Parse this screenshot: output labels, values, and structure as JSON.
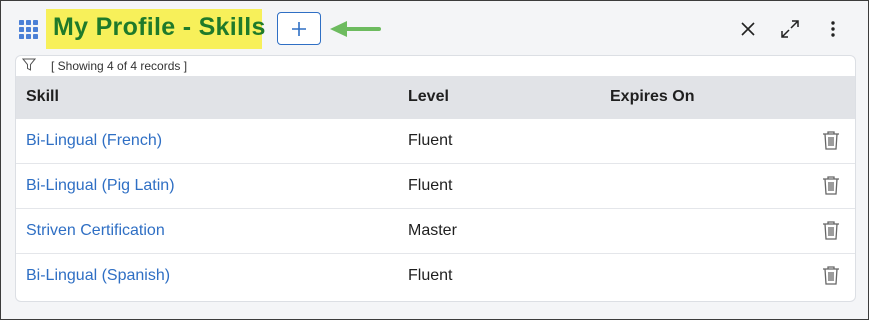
{
  "header": {
    "title": "My Profile - Skills",
    "add_label": "+",
    "title_highlight_color": "#f7f05a",
    "title_color": "#1f7a2a",
    "arrow_color": "#6dbb5f"
  },
  "list": {
    "record_count": "[ Showing 4 of 4 records ]",
    "columns": [
      "Skill",
      "Level",
      "Expires On"
    ],
    "rows": [
      {
        "skill": "Bi-Lingual (French)",
        "level": "Fluent",
        "expires": ""
      },
      {
        "skill": "Bi-Lingual (Pig Latin)",
        "level": "Fluent",
        "expires": ""
      },
      {
        "skill": "Striven Certification",
        "level": "Master",
        "expires": ""
      },
      {
        "skill": "Bi-Lingual (Spanish)",
        "level": "Fluent",
        "expires": ""
      }
    ]
  },
  "icons": {
    "menu": "grid-icon",
    "close": "close-icon",
    "expand": "expand-icon",
    "more": "more-vertical-icon",
    "filter": "filter-icon",
    "delete": "trash-icon"
  }
}
